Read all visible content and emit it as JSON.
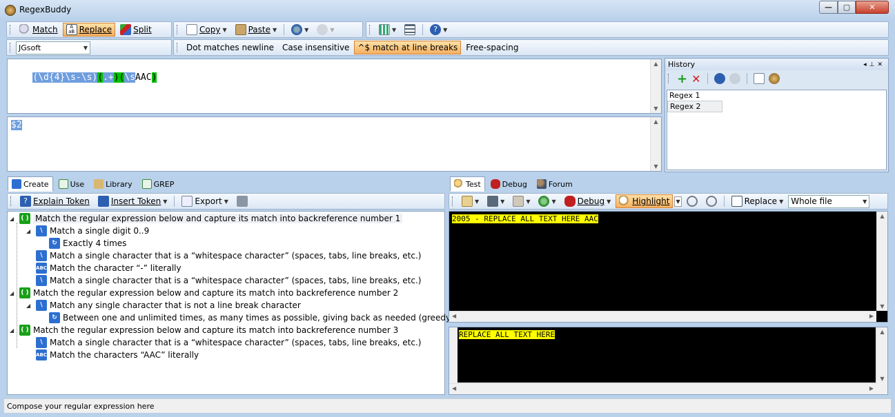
{
  "window": {
    "title": "RegexBuddy"
  },
  "toolbar1": {
    "match": "Match",
    "replace": "Replace",
    "split": "Split",
    "copy": "Copy",
    "paste": "Paste"
  },
  "toolbar2": {
    "flavor": "JGsoft",
    "dot_newline": "Dot matches newline",
    "case_insensitive": "Case insensitive",
    "caret_linebreaks": "^$ match at line breaks",
    "free_spacing": "Free-spacing"
  },
  "regex": {
    "g1_open": "(",
    "g1_body": "\\d{4}\\s-\\s",
    "g1_close": ")",
    "g2_open": "(",
    "g2_body": ".+",
    "g2_close": ")",
    "g3_open": "(",
    "g3_ws": "\\s",
    "g3_lit": "AAC",
    "g3_close": ")"
  },
  "replacement": {
    "text": "$2"
  },
  "history": {
    "title": "History",
    "items": [
      "Regex 1",
      "Regex 2"
    ]
  },
  "left_tabs": [
    "Create",
    "Use",
    "Library",
    "GREP"
  ],
  "create_toolbar": {
    "explain": "Explain Token",
    "insert": "Insert Token",
    "export": "Export"
  },
  "tree": [
    "Match the regular expression below and capture its match into backreference number 1",
    "Match a single digit 0..9",
    "Exactly 4 times",
    "Match a single character that is a “whitespace character” (spaces, tabs, line breaks, etc.)",
    "Match the character “-” literally",
    "Match a single character that is a “whitespace character” (spaces, tabs, line breaks, etc.)",
    "Match the regular expression below and capture its match into backreference number 2",
    "Match any single character that is not a line break character",
    "Between one and unlimited times, as many times as possible, giving back as needed (greedy)",
    "Match the regular expression below and capture its match into backreference number 3",
    "Match a single character that is a “whitespace character” (spaces, tabs, line breaks, etc.)",
    "Match the characters “AAC” literally"
  ],
  "right_tabs": [
    "Test",
    "Debug",
    "Forum"
  ],
  "test_toolbar": {
    "debug": "Debug",
    "highlight": "Highlight",
    "replace": "Replace",
    "scope": "Whole file"
  },
  "test": {
    "subject": "2005 - REPLACE ALL TEXT HERE AAC",
    "result": "REPLACE ALL TEXT HERE"
  },
  "status": {
    "text": "Compose your regular expression here"
  },
  "colors": {
    "accent": "#f5b060",
    "highlight_yellow": "#ffff00",
    "group_green": "#00c000",
    "regex_blue": "#6f9ede"
  }
}
